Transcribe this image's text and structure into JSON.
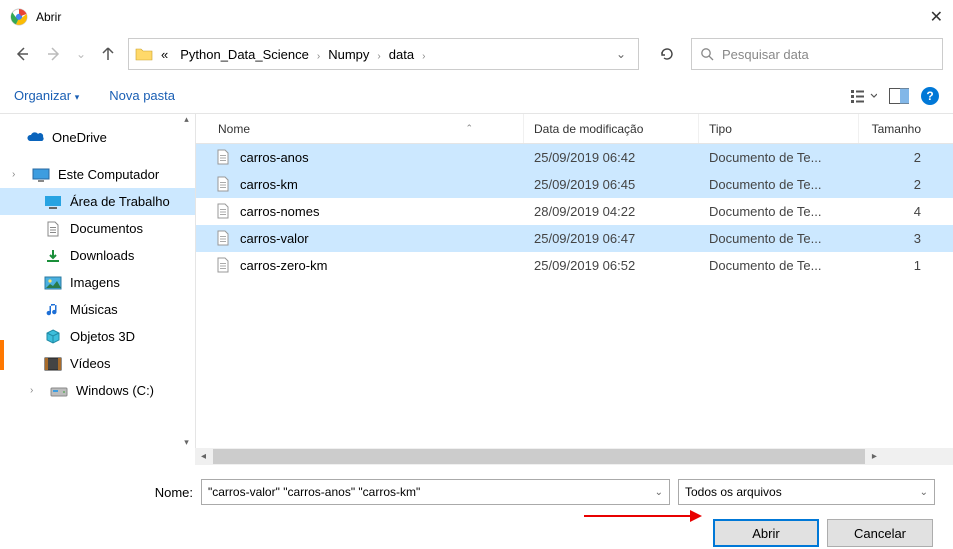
{
  "title": "Abrir",
  "breadcrumb": {
    "prefix": "«",
    "items": [
      "Python_Data_Science",
      "Numpy",
      "data"
    ]
  },
  "search": {
    "placeholder": "Pesquisar data"
  },
  "toolbar": {
    "organize": "Organizar",
    "newfolder": "Nova pasta"
  },
  "help_glyph": "?",
  "sidebar": {
    "items": [
      {
        "label": "OneDrive",
        "icon": "onedrive",
        "indent": false
      },
      {
        "label": "Este Computador",
        "icon": "pc",
        "indent": false,
        "expandable": true
      },
      {
        "label": "Área de Trabalho",
        "icon": "desktop",
        "indent": true,
        "active": true
      },
      {
        "label": "Documentos",
        "icon": "docs",
        "indent": true
      },
      {
        "label": "Downloads",
        "icon": "downloads",
        "indent": true
      },
      {
        "label": "Imagens",
        "icon": "images",
        "indent": true
      },
      {
        "label": "Músicas",
        "icon": "music",
        "indent": true
      },
      {
        "label": "Objetos 3D",
        "icon": "objects3d",
        "indent": true
      },
      {
        "label": "Vídeos",
        "icon": "videos",
        "indent": true
      },
      {
        "label": "Windows (C:)",
        "icon": "drive",
        "indent": true,
        "expandable": true
      }
    ]
  },
  "columns": {
    "name": "Nome",
    "date": "Data de modificação",
    "type": "Tipo",
    "size": "Tamanho"
  },
  "files": [
    {
      "name": "carros-anos",
      "date": "25/09/2019 06:42",
      "type": "Documento de Te...",
      "size": "2",
      "selected": true
    },
    {
      "name": "carros-km",
      "date": "25/09/2019 06:45",
      "type": "Documento de Te...",
      "size": "2",
      "selected": true
    },
    {
      "name": "carros-nomes",
      "date": "28/09/2019 04:22",
      "type": "Documento de Te...",
      "size": "4",
      "selected": false
    },
    {
      "name": "carros-valor",
      "date": "25/09/2019 06:47",
      "type": "Documento de Te...",
      "size": "3",
      "selected": true
    },
    {
      "name": "carros-zero-km",
      "date": "25/09/2019 06:52",
      "type": "Documento de Te...",
      "size": "1",
      "selected": false
    }
  ],
  "footer": {
    "label": "Nome:",
    "value": "\"carros-valor\" \"carros-anos\" \"carros-km\"",
    "filter": "Todos os arquivos",
    "open": "Abrir",
    "cancel": "Cancelar"
  }
}
